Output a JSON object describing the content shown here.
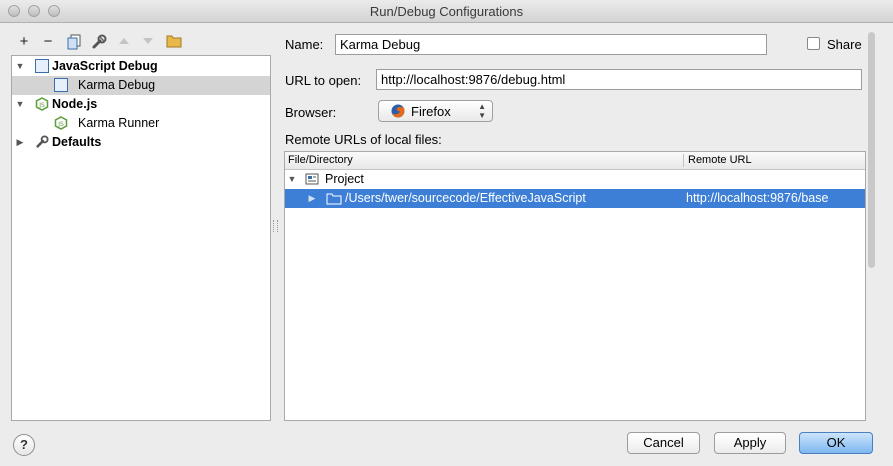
{
  "window": {
    "title": "Run/Debug Configurations"
  },
  "toolbar": {
    "icons": [
      "add-icon",
      "remove-icon",
      "copy-icon",
      "wrench-icon",
      "move-up-icon",
      "move-down-icon",
      "folder-icon"
    ],
    "add_glyph": "+",
    "remove_glyph": "−"
  },
  "tree": {
    "nodes": [
      {
        "label": "JavaScript Debug",
        "expanded": true,
        "icon": "javascript-debug-icon",
        "bold": true
      },
      {
        "label": "Karma Debug",
        "selected": true,
        "icon": "karma-debug-icon"
      },
      {
        "label": "Node.js",
        "expanded": true,
        "icon": "nodejs-icon",
        "bold": true
      },
      {
        "label": "Karma Runner",
        "icon": "nodejs-icon"
      },
      {
        "label": "Defaults",
        "expanded": false,
        "icon": "wrench-icon",
        "bold": true
      }
    ]
  },
  "form": {
    "name_label": "Name:",
    "name_value": "Karma Debug",
    "share_label": "Share",
    "share_checked": false,
    "url_label": "URL to open:",
    "url_value": "http://localhost:9876/debug.html",
    "browser_label": "Browser:",
    "browser_value": "Firefox",
    "remote_label": "Remote URLs of local files:"
  },
  "table": {
    "columns": [
      "File/Directory",
      "Remote URL"
    ],
    "rows": [
      {
        "path": "Project",
        "url": "",
        "expanded": true
      },
      {
        "path": "/Users/twer/sourcecode/EffectiveJavaScript",
        "url": "http://localhost:9876/base",
        "selected": true
      }
    ]
  },
  "buttons": {
    "help": "?",
    "cancel": "Cancel",
    "apply": "Apply",
    "ok": "OK"
  },
  "colors": {
    "selection": "#3d7fd6",
    "tree_selection": "#d4d4d4"
  }
}
